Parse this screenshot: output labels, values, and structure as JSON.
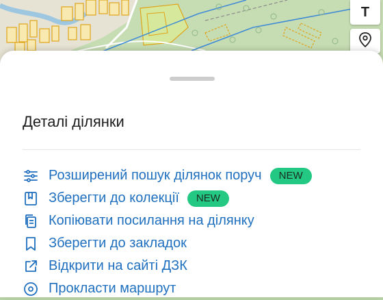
{
  "map_controls": {
    "text_tool_label": "T"
  },
  "sheet": {
    "title": "Деталі ділянки",
    "actions": [
      {
        "label": "Розширений пошук ділянок поруч",
        "badge": "NEW",
        "icon": "sliders-icon"
      },
      {
        "label": "Зберегти до колекції",
        "badge": "NEW",
        "icon": "collection-icon"
      },
      {
        "label": "Копіювати посилання на ділянку",
        "icon": "copy-icon"
      },
      {
        "label": "Зберегти до закладок",
        "icon": "bookmark-icon"
      },
      {
        "label": "Відкрити на сайті ДЗК",
        "icon": "external-link-icon"
      },
      {
        "label": "Прокласти маршрут",
        "icon": "route-icon"
      }
    ]
  },
  "colors": {
    "link": "#1f6fbf",
    "badge": "#23c983",
    "map_parcel_outline": "#e0a419"
  }
}
